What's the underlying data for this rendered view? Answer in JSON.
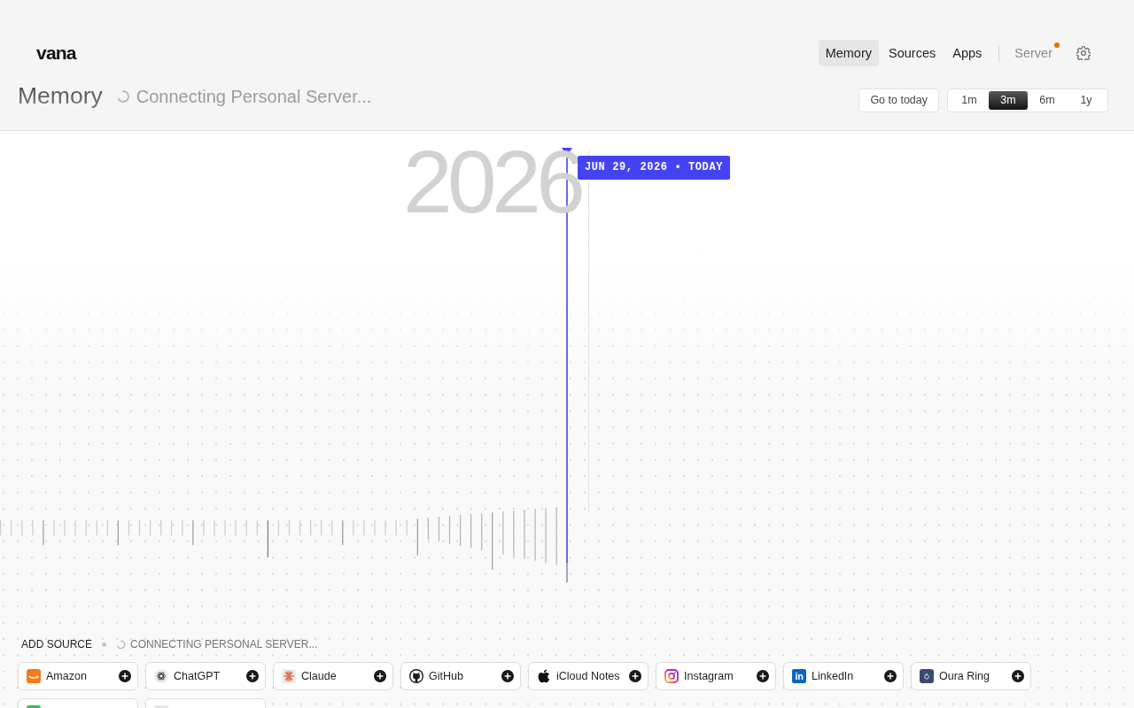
{
  "header": {
    "logo": "vana",
    "nav": [
      {
        "label": "Memory",
        "selected": true
      },
      {
        "label": "Sources",
        "selected": false
      },
      {
        "label": "Apps",
        "selected": false
      }
    ],
    "server": {
      "label": "Server",
      "alert": true
    },
    "title": "Memory",
    "status": {
      "text": "Connecting Personal Server...",
      "loading": true
    },
    "go_to_today": "Go to today",
    "ranges": [
      {
        "label": "1m",
        "selected": false
      },
      {
        "label": "3m",
        "selected": true
      },
      {
        "label": "6m",
        "selected": false
      },
      {
        "label": "1y",
        "selected": false
      }
    ]
  },
  "timeline": {
    "year": "2026",
    "today_label": "JUN 29, 2026 • TODAY"
  },
  "add_source": {
    "heading": "ADD SOURCE",
    "status": {
      "text": "CONNECTING PERSONAL SERVER...",
      "loading": true
    },
    "sources": [
      {
        "label": "Amazon"
      },
      {
        "label": "ChatGPT"
      },
      {
        "label": "Claude"
      },
      {
        "label": "GitHub"
      },
      {
        "label": "iCloud Notes"
      },
      {
        "label": "Instagram"
      },
      {
        "label": "LinkedIn",
        "icon_text": "in"
      },
      {
        "label": "Oura Ring"
      }
    ],
    "partial_sources": [
      {
        "color": "#22c55e"
      },
      {
        "color": "#e6e6e6"
      }
    ]
  }
}
